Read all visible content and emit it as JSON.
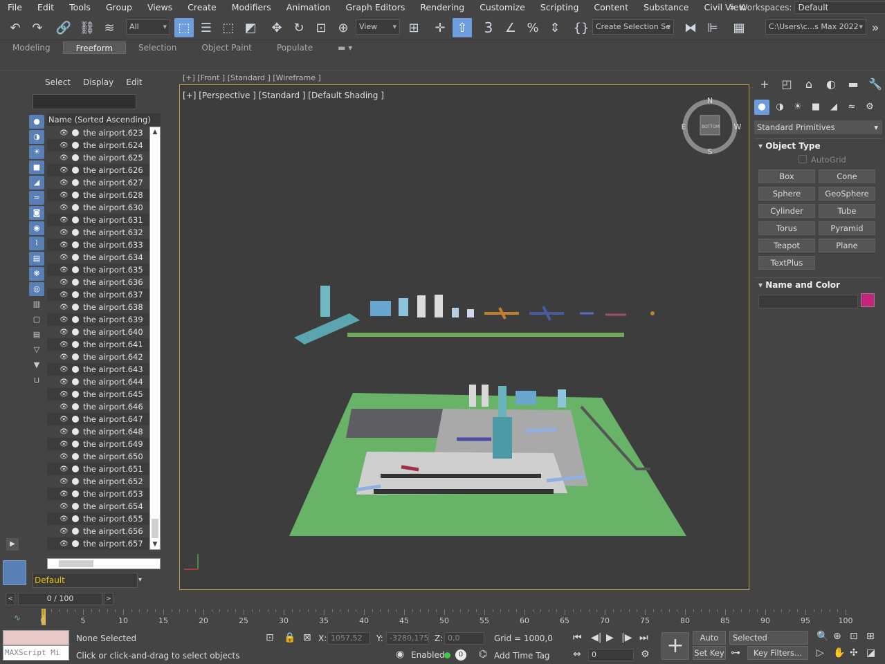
{
  "menu": {
    "items": [
      "File",
      "Edit",
      "Tools",
      "Group",
      "Views",
      "Create",
      "Modifiers",
      "Animation",
      "Graph Editors",
      "Rendering",
      "Customize",
      "Scripting",
      "Content",
      "Substance",
      "Civil View"
    ],
    "more": "»",
    "workspaces_label": "Workspaces:",
    "workspaces_value": "Default"
  },
  "toolbar": {
    "filter_value": "All",
    "view_value": "View",
    "create_selection_value": "Create Selection Se",
    "path_value": "C:\\Users\\c...s Max 2022",
    "snap_label": "3",
    "accent": "#6d9ddc"
  },
  "ribbon": {
    "tabs": [
      "Modeling",
      "Freeform",
      "Selection",
      "Object Paint",
      "Populate"
    ],
    "active_index": 1
  },
  "scene_explorer": {
    "tabs": [
      "Select",
      "Display",
      "Edit"
    ],
    "column_header": "Name (Sorted Ascending)",
    "items": [
      "the airport.623",
      "the airport.624",
      "the airport.625",
      "the airport.626",
      "the airport.627",
      "the airport.628",
      "the airport.630",
      "the airport.631",
      "the airport.632",
      "the airport.633",
      "the airport.634",
      "the airport.635",
      "the airport.636",
      "the airport.637",
      "the airport.638",
      "the airport.639",
      "the airport.640",
      "the airport.641",
      "the airport.642",
      "the airport.643",
      "the airport.644",
      "the airport.645",
      "the airport.646",
      "the airport.647",
      "the airport.648",
      "the airport.649",
      "the airport.650",
      "the airport.651",
      "the airport.652",
      "the airport.653",
      "the airport.654",
      "the airport.655",
      "the airport.656",
      "the airport.657"
    ],
    "layer_value": "Default"
  },
  "viewport": {
    "label": "[+] [Perspective ] [Standard ] [Default Shading ]",
    "top_label": "[+] [Front ] [Standard ] [Wireframe ]",
    "viewcube": {
      "n": "N",
      "s": "S",
      "e": "E",
      "w": "W",
      "face": "BOTTOM"
    },
    "border_color": "#bba34a"
  },
  "time_slider": {
    "value": "0 / 100",
    "prev": "<",
    "next": ">"
  },
  "track_ticks": [
    "0",
    "5",
    "10",
    "15",
    "20",
    "25",
    "30",
    "35",
    "40",
    "45",
    "50",
    "55",
    "60",
    "65",
    "70",
    "75",
    "80",
    "85",
    "90",
    "95",
    "100"
  ],
  "status": {
    "maxscript_placeholder": "MAXScript Mi",
    "selection": "None Selected",
    "prompt": "Click or click-and-drag to select objects",
    "x_label": "X:",
    "x_value": "1057,52",
    "y_label": "Y:",
    "y_value": "-3280,175",
    "z_label": "Z:",
    "z_value": "0,0",
    "grid": "Grid = 1000,0",
    "enabled_label": "Enabled:",
    "enabled_value": "0",
    "add_time_tag": "Add Time Tag",
    "auto_key": "Auto Key",
    "set_key": "Set Key",
    "selected_dd": "Selected",
    "key_filters": "Key Filters...",
    "frame_value": "0"
  },
  "command_panel": {
    "category": "Standard Primitives",
    "object_type_title": "Object Type",
    "autogrid": "AutoGrid",
    "primitives": [
      "Box",
      "Cone",
      "Sphere",
      "GeoSphere",
      "Cylinder",
      "Tube",
      "Torus",
      "Pyramid",
      "Teapot",
      "Plane",
      "TextPlus"
    ],
    "name_color_title": "Name and Color",
    "swatch_color": "#c6227e"
  }
}
